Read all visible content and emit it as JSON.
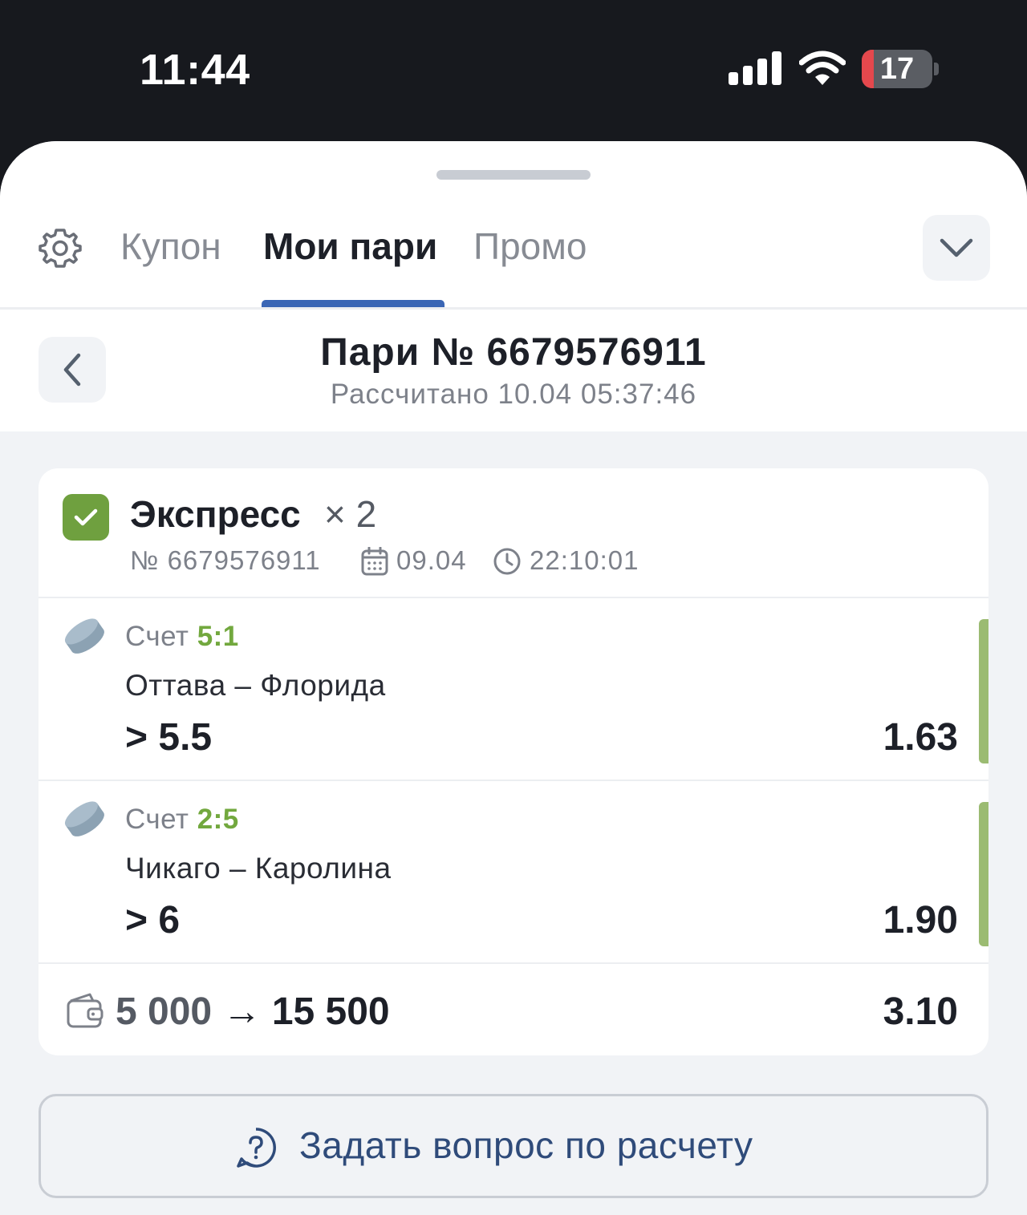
{
  "status_bar": {
    "time": "11:44",
    "battery_level": 17,
    "battery_text": "17",
    "icons": [
      "signal-icon",
      "wifi-icon",
      "battery-icon"
    ]
  },
  "tabs": [
    {
      "label": "Купон",
      "active": false
    },
    {
      "label": "Мои пари",
      "active": true
    },
    {
      "label": "Промо",
      "active": false
    }
  ],
  "bet_header": {
    "title": "Пари № 6679576911",
    "subtitle": "Рассчитано 10.04 05:37:46"
  },
  "card": {
    "type_label": "Экспресс",
    "multiplier": "× 2",
    "number": "№ 6679576911",
    "date": "09.04",
    "time": "22:10:01",
    "status": "won",
    "events": [
      {
        "score_label": "Счет",
        "score": "5:1",
        "match": "Оттава – Флорида",
        "outcome": "> 5.5",
        "odds": "1.63"
      },
      {
        "score_label": "Счет",
        "score": "2:5",
        "match": "Чикаго – Каролина",
        "outcome": "> 6",
        "odds": "1.90"
      }
    ],
    "stake": "5 000",
    "arrow": "→",
    "payout": "15 500",
    "total_odds": "3.10"
  },
  "question_button": {
    "label": "Задать вопрос по расчету"
  },
  "colors": {
    "accent": "#3a66b5",
    "won": "#6fa03f",
    "score": "#72a83e",
    "link": "#2f4b7a"
  }
}
